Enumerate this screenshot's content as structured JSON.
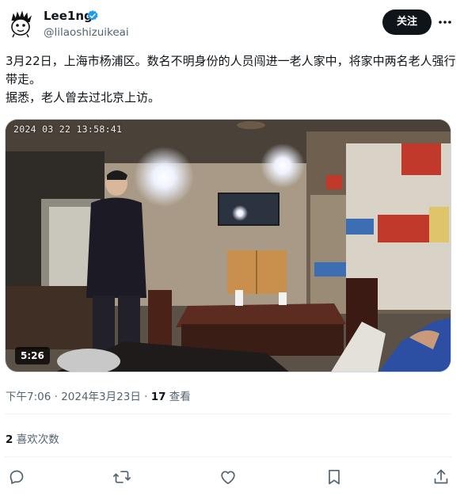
{
  "author": {
    "display_name": "Lee1ng",
    "handle": "@lilaoshizuikeai",
    "verified": true
  },
  "follow_button": {
    "label": "关注"
  },
  "tweet": {
    "text": "3月22日，上海市杨浦区。数名不明身份的人员闯进一老人家中，将家中两名老人强行带走。\n据悉，老人曾去过北京上访。"
  },
  "video": {
    "timestamp_overlay": "2024 03 22 13:58:41",
    "duration": "5:26"
  },
  "meta": {
    "time": "下午7:06",
    "separator": " · ",
    "date": "2024年3月23日",
    "views_count": "17",
    "views_label": " 查看"
  },
  "engagement": {
    "likes_count": "2",
    "likes_label": " 喜欢次数"
  },
  "actions": [
    "reply-icon",
    "retweet-icon",
    "like-icon",
    "bookmark-icon",
    "share-icon"
  ],
  "colors": {
    "text_primary": "#0f1419",
    "text_secondary": "#536471",
    "verified_blue": "#1d9bf0",
    "divider": "#eff3f4",
    "follow_button_bg": "#0f1419"
  }
}
